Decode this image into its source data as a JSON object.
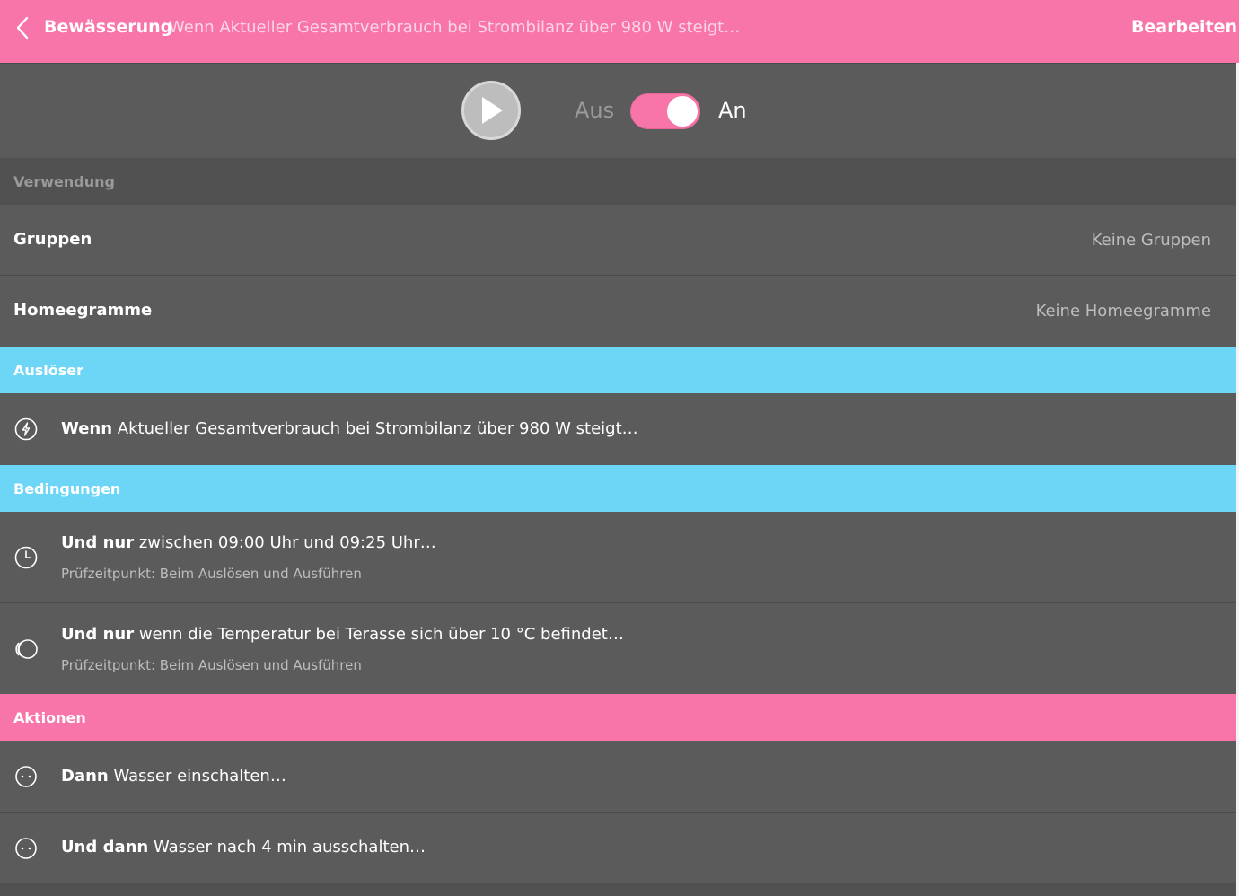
{
  "header": {
    "title": "Bewässerung",
    "subtitle": "Wenn Aktueller Gesamtverbrauch bei Strombilanz über 980 W steigt…",
    "edit_label": "Bearbeiten",
    "back_icon": "chevron-left-icon",
    "color": "#f875a9"
  },
  "controls": {
    "play_icon": "play-icon",
    "off_label": "Aus",
    "on_label": "An",
    "toggle_state": "on"
  },
  "usage": {
    "section_title": "Verwendung",
    "groups_label": "Gruppen",
    "groups_value": "Keine Gruppen",
    "homeegrams_label": "Homeegramme",
    "homeegrams_value": "Keine Homeegramme"
  },
  "triggers": {
    "section_title": "Auslöser",
    "color": "#6dd6f7",
    "items": [
      {
        "icon": "power-meter-icon",
        "prefix": "Wenn",
        "text": "Aktueller Gesamtverbrauch bei Strombilanz über 980 W steigt…"
      }
    ]
  },
  "conditions": {
    "section_title": "Bedingungen",
    "color": "#6dd6f7",
    "items": [
      {
        "icon": "clock-icon",
        "prefix": "Und nur",
        "text": "zwischen 09:00 Uhr und 09:25 Uhr…",
        "sub": "Prüfzeitpunkt: Beim Auslösen und Ausführen"
      },
      {
        "icon": "temperature-sensor-icon",
        "prefix": "Und nur",
        "text": "wenn die Temperatur bei Terasse sich über 10 °C befindet…",
        "sub": "Prüfzeitpunkt: Beim Auslösen und Ausführen"
      }
    ]
  },
  "actions": {
    "section_title": "Aktionen",
    "color": "#f875a9",
    "items": [
      {
        "icon": "water-valve-icon",
        "prefix": "Dann",
        "text": "Wasser einschalten…"
      },
      {
        "icon": "water-valve-icon",
        "prefix": "Und dann",
        "text": "Wasser nach 4 min ausschalten…"
      }
    ]
  }
}
